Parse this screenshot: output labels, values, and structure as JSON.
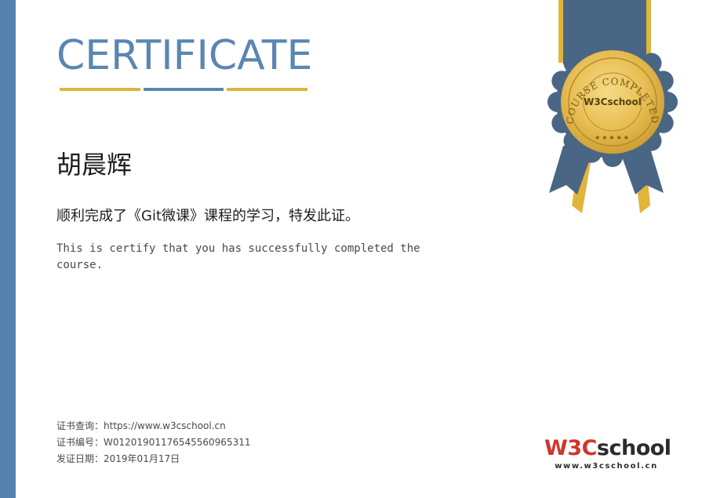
{
  "certificate": {
    "title": "CERTIFICATE",
    "recipient_name": "胡晨辉",
    "completion_zh": "顺利完成了《Git微课》课程的学习，特发此证。",
    "completion_en": "This is certify that you has successfully completed the course."
  },
  "footer": {
    "lookup_label": "证书查询：",
    "lookup_value": "https://www.w3cschool.cn",
    "number_label": "证书编号：",
    "number_value": "W01201901176545560965311",
    "date_label": "发证日期：",
    "date_value": "2019年01月17日"
  },
  "seal": {
    "arc_text": "COURSE COMPLETED",
    "center_text": "W3Cschool"
  },
  "logo": {
    "brand_red": "W3C",
    "brand_dark": "school",
    "url": "www.w3cschool.cn"
  },
  "colors": {
    "accent_blue": "#5481ad",
    "ribbon_blue": "#4a6685",
    "gold": "#e2b43b",
    "logo_red": "#d0362b"
  }
}
